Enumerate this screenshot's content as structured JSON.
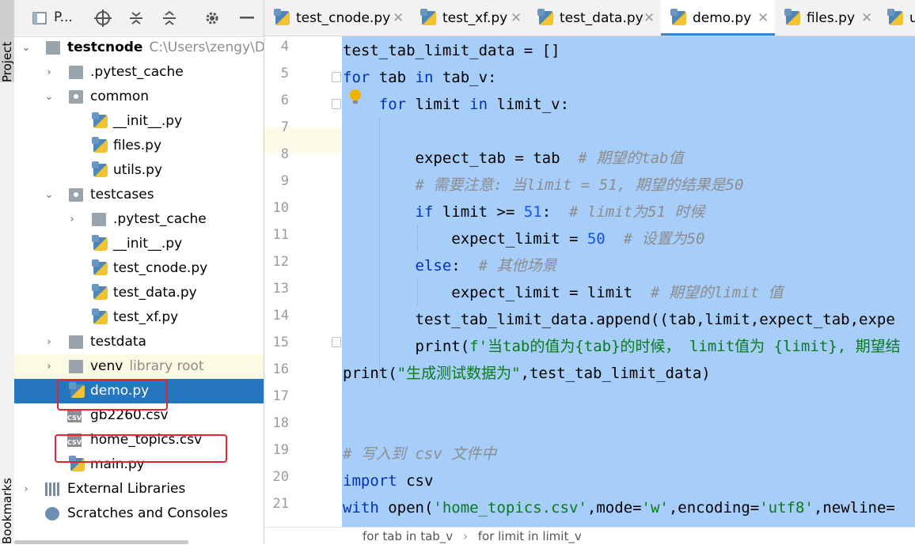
{
  "side_tabs": {
    "project": "Project",
    "bookmarks": "Bookmarks"
  },
  "project_panel": {
    "title": "P...",
    "tree": [
      {
        "label": "testcnode",
        "hint": "C:\\Users\\zengy\\Des",
        "kind": "root",
        "expanded": true
      },
      {
        "label": ".pytest_cache",
        "kind": "folder",
        "expanded": false
      },
      {
        "label": "common",
        "kind": "package",
        "expanded": true
      },
      {
        "label": "__init__.py",
        "kind": "py"
      },
      {
        "label": "files.py",
        "kind": "py"
      },
      {
        "label": "utils.py",
        "kind": "py"
      },
      {
        "label": "testcases",
        "kind": "package",
        "expanded": true
      },
      {
        "label": ".pytest_cache",
        "kind": "folder",
        "expanded": false
      },
      {
        "label": "__init__.py",
        "kind": "py"
      },
      {
        "label": "test_cnode.py",
        "kind": "py"
      },
      {
        "label": "test_data.py",
        "kind": "py"
      },
      {
        "label": "test_xf.py",
        "kind": "py"
      },
      {
        "label": "testdata",
        "kind": "folder",
        "expanded": false
      },
      {
        "label": "venv",
        "hint": "library root",
        "kind": "folder",
        "expanded": false
      },
      {
        "label": "demo.py",
        "kind": "py",
        "selected": true
      },
      {
        "label": "gb2260.csv",
        "kind": "csv"
      },
      {
        "label": "home_topics.csv",
        "kind": "csv"
      },
      {
        "label": "main.py",
        "kind": "py"
      },
      {
        "label": "External Libraries",
        "kind": "lib",
        "expanded": false
      },
      {
        "label": "Scratches and Consoles",
        "kind": "scratch"
      }
    ]
  },
  "tabs": [
    {
      "label": "test_cnode.py",
      "active": false
    },
    {
      "label": "test_xf.py",
      "active": false
    },
    {
      "label": "test_data.py",
      "active": false
    },
    {
      "label": "demo.py",
      "active": true
    },
    {
      "label": "files.py",
      "active": false
    },
    {
      "label": "u",
      "active": false
    }
  ],
  "editor": {
    "line_numbers": [
      "4",
      "5",
      "6",
      "7",
      "8",
      "9",
      "10",
      "11",
      "12",
      "13",
      "14",
      "15",
      "16",
      "17",
      "18",
      "19",
      "20",
      "21"
    ],
    "lines": [
      "test_tab_limit_data = []",
      "for tab in tab_v:",
      "    for limit in limit_v:",
      "",
      "        expect_tab = tab  # 期望的tab值",
      "        # 需要注意: 当limit = 51, 期望的结果是50",
      "        if limit >= 51:  # limit为51 时候",
      "            expect_limit = 50  # 设置为50",
      "        else:  # 其他场景",
      "            expect_limit = limit  # 期望的limit 值",
      "        test_tab_limit_data.append((tab,limit,expect_tab,expe",
      "        print(f'当tab的值为{tab}的时候， limit值为 {limit}, 期望结",
      "print(\"生成测试数据为\",test_tab_limit_data)",
      "",
      "",
      "# 写入到 csv 文件中",
      "import csv",
      "with open('home_topics.csv',mode='w',encoding='utf8',newline="
    ]
  },
  "breadcrumb": {
    "items": [
      "for tab in tab_v",
      "for limit in limit_v"
    ],
    "separator": "›"
  },
  "colors": {
    "selection": "#a7cdf9",
    "tree_selected": "#2675bf",
    "keyword": "#0033b3",
    "number": "#1750eb",
    "string": "#067d17",
    "comment": "#8c8c8c",
    "highlight_box": "#e0262e"
  },
  "icons": [
    "folder-icon",
    "package-icon",
    "python-file-icon",
    "csv-file-icon",
    "libraries-icon",
    "scratches-icon",
    "locate-icon",
    "expand-all-icon",
    "collapse-all-icon",
    "gear-icon",
    "minimize-icon",
    "close-icon",
    "lightbulb-icon"
  ]
}
